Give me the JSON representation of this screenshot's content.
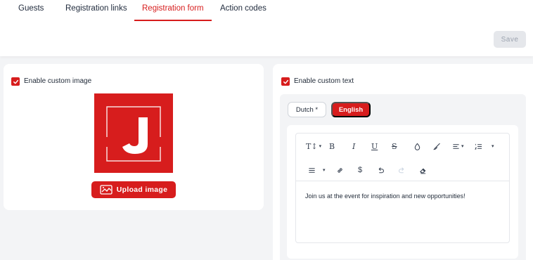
{
  "tabs": [
    {
      "label": "Guests"
    },
    {
      "label": "Registration links"
    },
    {
      "label": "Registration form"
    },
    {
      "label": "Action codes"
    }
  ],
  "header": {
    "save_label": "Save"
  },
  "left_card": {
    "checkbox_label": "Enable custom image",
    "upload_label": "Upload image",
    "logo_letter": "J"
  },
  "right_card": {
    "checkbox_label": "Enable custom text",
    "languages": [
      {
        "label": "Dutch *",
        "active": false
      },
      {
        "label": "English",
        "active": true
      }
    ],
    "toolbar": {
      "bold": "B",
      "italic": "I",
      "underline": "U",
      "strike": "S",
      "font_size": "T↕",
      "dollar": "$"
    },
    "content": "Join us at the event for inspiration and new opportunities!"
  },
  "colors": {
    "accent": "#d71d1d",
    "disabled_bg": "#e5e7eb"
  }
}
